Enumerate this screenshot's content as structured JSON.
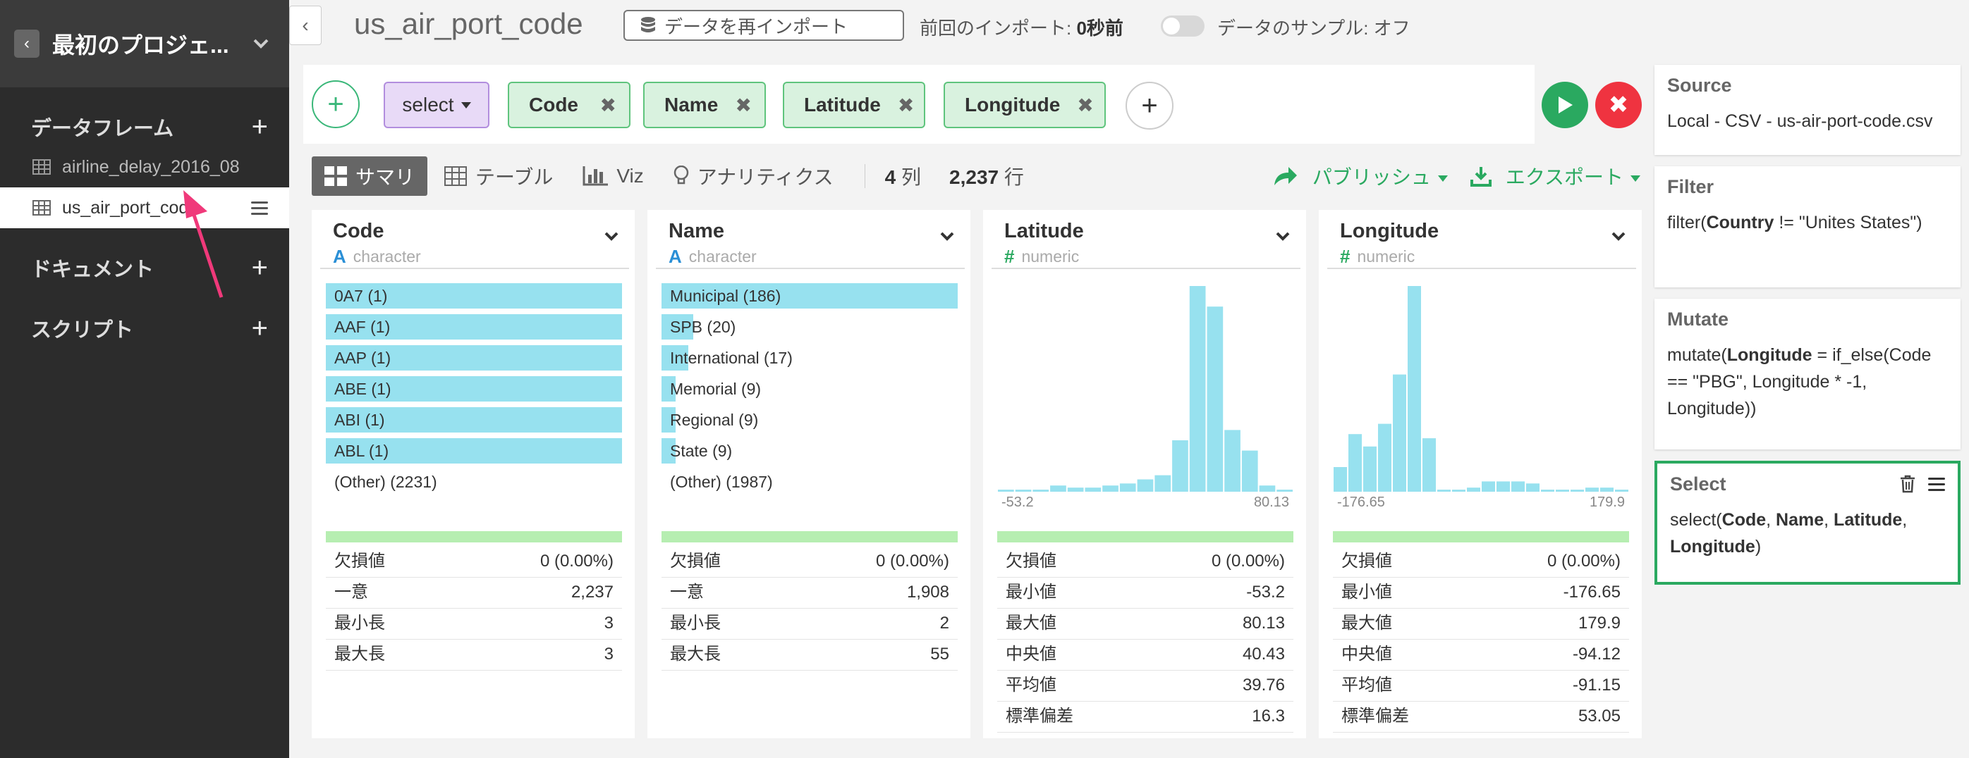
{
  "colors": {
    "accent": "#2aa960",
    "danger": "#ef3340",
    "bar": "#97e1ef",
    "pink": "#f0397a"
  },
  "sidebar": {
    "project_title": "最初のプロジェ...",
    "sections": {
      "dataframes": "データフレーム",
      "documents": "ドキュメント",
      "scripts": "スクリプト"
    },
    "dataframes": [
      {
        "label": "airline_delay_2016_08"
      },
      {
        "label": "us_air_port_code"
      }
    ]
  },
  "topbar": {
    "title": "us_air_port_code",
    "reimport_label": "データを再インポート",
    "last_import_label": "前回のインポート: ",
    "last_import_value": "0秒前",
    "sample_label": "データのサンプル: オフ"
  },
  "pipeline": {
    "function_label": "select",
    "columns": [
      "Code",
      "Name",
      "Latitude",
      "Longitude"
    ]
  },
  "view": {
    "tabs": [
      "サマリ",
      "テーブル",
      "Viz",
      "アナリティクス"
    ],
    "col_count": "4",
    "col_unit": " 列",
    "row_count": "2,237",
    "row_unit": " 行",
    "publish_label": "パブリッシュ",
    "export_label": "エクスポート"
  },
  "cards": [
    {
      "name": "Code",
      "type": "character",
      "bars": [
        {
          "label": "0A7 (1)",
          "fraction": 1.0
        },
        {
          "label": "AAF (1)",
          "fraction": 1.0
        },
        {
          "label": "AAP (1)",
          "fraction": 1.0
        },
        {
          "label": "ABE (1)",
          "fraction": 1.0
        },
        {
          "label": "ABI (1)",
          "fraction": 1.0
        },
        {
          "label": "ABL (1)",
          "fraction": 1.0
        },
        {
          "label": "(Other) (2231)",
          "fraction": 0
        }
      ],
      "stats": [
        {
          "label": "欠損値",
          "value": "0 (0.00%)"
        },
        {
          "label": "一意",
          "value": "2,237"
        },
        {
          "label": "最小長",
          "value": "3"
        },
        {
          "label": "最大長",
          "value": "3"
        }
      ]
    },
    {
      "name": "Name",
      "type": "character",
      "bars": [
        {
          "label": "Municipal (186)",
          "fraction": 1.0
        },
        {
          "label": "SPB (20)",
          "fraction": 0.108
        },
        {
          "label": "International (17)",
          "fraction": 0.091
        },
        {
          "label": "Memorial (9)",
          "fraction": 0.048
        },
        {
          "label": "Regional (9)",
          "fraction": 0.048
        },
        {
          "label": "State (9)",
          "fraction": 0.048
        },
        {
          "label": "(Other) (1987)",
          "fraction": 0
        }
      ],
      "stats": [
        {
          "label": "欠損値",
          "value": "0 (0.00%)"
        },
        {
          "label": "一意",
          "value": "1,908"
        },
        {
          "label": "最小長",
          "value": "2"
        },
        {
          "label": "最大長",
          "value": "55"
        }
      ]
    },
    {
      "name": "Latitude",
      "type": "numeric",
      "hist": {
        "min_label": "-53.2",
        "max_label": "80.13",
        "counts": [
          1,
          1,
          1,
          3,
          2,
          2,
          3,
          4,
          6,
          8,
          25,
          100,
          90,
          30,
          20,
          3,
          1
        ]
      },
      "stats": [
        {
          "label": "欠損値",
          "value": "0 (0.00%)"
        },
        {
          "label": "最小値",
          "value": "-53.2"
        },
        {
          "label": "最大値",
          "value": "80.13"
        },
        {
          "label": "中央値",
          "value": "40.43"
        },
        {
          "label": "平均値",
          "value": "39.76"
        },
        {
          "label": "標準偏差",
          "value": "16.3"
        }
      ]
    },
    {
      "name": "Longitude",
      "type": "numeric",
      "hist": {
        "min_label": "-176.65",
        "max_label": "179.9",
        "counts": [
          12,
          28,
          22,
          33,
          57,
          100,
          26,
          1,
          1,
          2,
          5,
          5,
          5,
          4,
          1,
          1,
          1,
          2,
          2,
          1
        ]
      },
      "stats": [
        {
          "label": "欠損値",
          "value": "0 (0.00%)"
        },
        {
          "label": "最小値",
          "value": "-176.65"
        },
        {
          "label": "最大値",
          "value": "179.9"
        },
        {
          "label": "中央値",
          "value": "-94.12"
        },
        {
          "label": "平均値",
          "value": "-91.15"
        },
        {
          "label": "標準偏差",
          "value": "53.05"
        }
      ]
    }
  ],
  "steps": [
    {
      "title": "Source",
      "body": "Local - CSV - us-air-port-code.csv"
    },
    {
      "title": "Filter",
      "body_html": "filter(<b>Country</b> != \"Unites States\")"
    },
    {
      "title": "Mutate",
      "body_html": "mutate(<b>Longitude</b> = if_else(Code == \"PBG\", Longitude * -1, Longitude))"
    },
    {
      "title": "Select",
      "body_html": "select(<b>Code</b>, <b>Name</b>, <b>Latitude</b>, <b>Longitude</b>)"
    }
  ]
}
